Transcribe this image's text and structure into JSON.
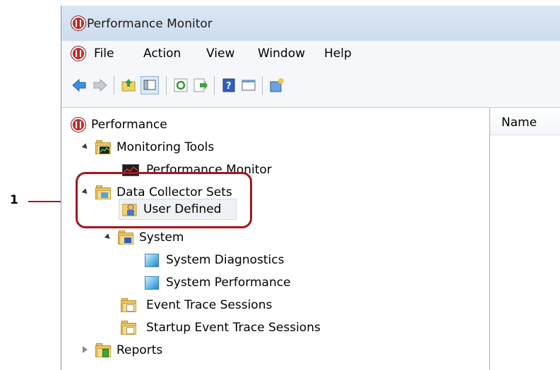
{
  "window": {
    "title": "Performance Monitor"
  },
  "menubar": {
    "items": [
      "File",
      "Action",
      "View",
      "Window",
      "Help"
    ]
  },
  "toolbar": {
    "buttons": [
      "back-icon",
      "forward-icon",
      "up-folder-icon",
      "show-hide-tree-icon",
      "refresh-icon",
      "export-icon",
      "help-icon",
      "properties-icon",
      "new-window-icon"
    ]
  },
  "tree": {
    "root": "Performance",
    "monitoring_tools": "Monitoring Tools",
    "performance_monitor": "Performance Monitor",
    "data_collector_sets": "Data Collector Sets",
    "user_defined": "User Defined",
    "system": "System",
    "system_diagnostics": "System Diagnostics",
    "system_performance": "System Performance",
    "event_trace_sessions": "Event Trace Sessions",
    "startup_event_trace_sessions": "Startup Event Trace Sessions",
    "reports": "Reports"
  },
  "right_pane": {
    "column_name": "Name"
  },
  "callout": {
    "number": "1",
    "color": "#a8161a"
  }
}
